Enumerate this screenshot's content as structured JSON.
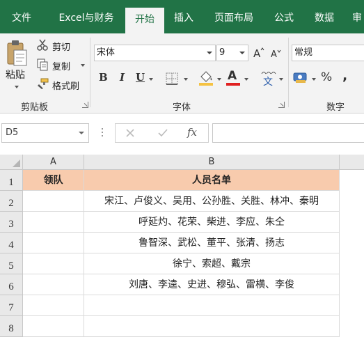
{
  "tabs": [
    {
      "label": "文件",
      "active": false
    },
    {
      "label": "Excel与财务",
      "active": false
    },
    {
      "label": "开始",
      "active": true
    },
    {
      "label": "插入",
      "active": false
    },
    {
      "label": "页面布局",
      "active": false
    },
    {
      "label": "公式",
      "active": false
    },
    {
      "label": "数据",
      "active": false
    },
    {
      "label": "审",
      "active": false
    }
  ],
  "clipboard": {
    "paste_label": "粘贴",
    "cut_label": "剪切",
    "copy_label": "复制",
    "format_painter_label": "格式刷",
    "group_label": "剪贴板"
  },
  "font": {
    "font_name": "宋体",
    "font_size": "9",
    "bold": "B",
    "italic": "I",
    "underline": "U",
    "color_letter": "A",
    "wen": "文",
    "group_label": "字体",
    "font_color": "#e02020",
    "fill_color": "#f5c242"
  },
  "number": {
    "format": "常规",
    "percent": "%",
    "comma": ",",
    "group_label": "数字"
  },
  "formula_bar": {
    "name_box": "D5",
    "fx": "fx",
    "content": ""
  },
  "sheet": {
    "columns": [
      "A",
      "B"
    ],
    "rows": [
      "1",
      "2",
      "3",
      "4",
      "5",
      "6",
      "7",
      "8"
    ],
    "cells": [
      [
        "领队",
        "人员名单"
      ],
      [
        "",
        "宋江、卢俊义、吴用、公孙胜、关胜、林冲、秦明"
      ],
      [
        "",
        "呼延灼、花荣、柴进、李应、朱仝"
      ],
      [
        "",
        "鲁智深、武松、董平、张清、扬志"
      ],
      [
        "",
        "徐宁、索超、戴宗"
      ],
      [
        "",
        "刘唐、李逵、史进、穆弘、雷横、李俊"
      ],
      [
        "",
        ""
      ],
      [
        "",
        ""
      ]
    ],
    "header_fill": "#f8cbad"
  }
}
